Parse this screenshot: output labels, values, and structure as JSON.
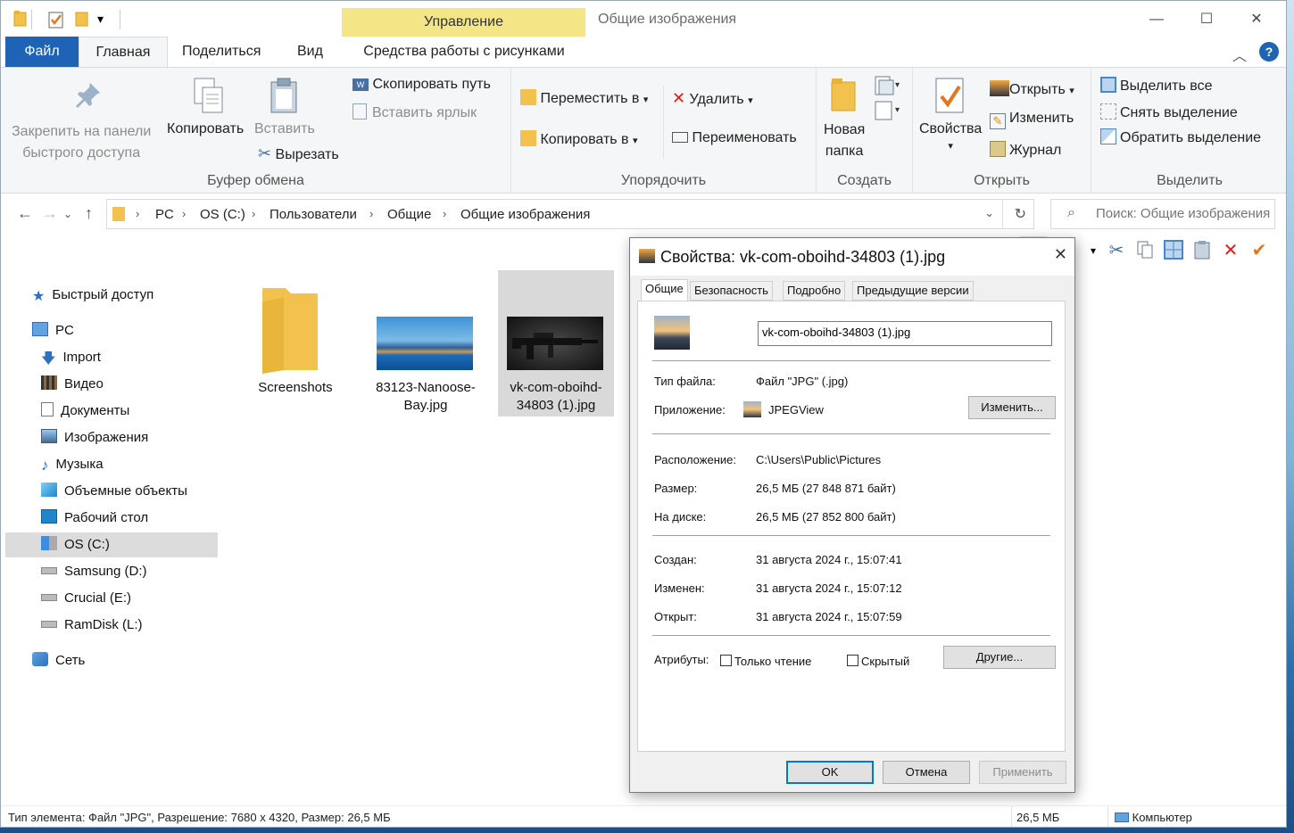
{
  "titlebar": {
    "context_tab": "Управление",
    "window_title": "Общие изображения",
    "minimize": "—",
    "maximize": "☐",
    "close": "✕"
  },
  "tabs": {
    "file": "Файл",
    "home": "Главная",
    "share": "Поделиться",
    "view": "Вид",
    "tools": "Средства работы с рисунками"
  },
  "ribbon": {
    "clipboard": {
      "pin": "Закрепить на панели быстрого доступа",
      "pin_line1": "Закрепить на панели",
      "pin_line2": "быстрого доступа",
      "copy": "Копировать",
      "paste": "Вставить",
      "copy_path": "Скопировать путь",
      "paste_shortcut": "Вставить ярлык",
      "cut": "Вырезать",
      "label": "Буфер обмена"
    },
    "organize": {
      "move_to": "Переместить в",
      "copy_to": "Копировать в",
      "delete": "Удалить",
      "rename": "Переименовать",
      "label": "Упорядочить"
    },
    "new": {
      "new_folder_line1": "Новая",
      "new_folder_line2": "папка",
      "label": "Создать"
    },
    "open": {
      "properties": "Свойства",
      "open": "Открыть",
      "edit": "Изменить",
      "history": "Журнал",
      "label": "Открыть"
    },
    "select": {
      "select_all": "Выделить все",
      "select_none": "Снять выделение",
      "invert": "Обратить выделение",
      "label": "Выделить"
    }
  },
  "address": {
    "crumbs": [
      "PC",
      "OS (C:)",
      "Пользователи",
      "Общие",
      "Общие изображения"
    ],
    "search_placeholder": "Поиск: Общие изображения"
  },
  "navpane": {
    "quick_access": "Быстрый доступ",
    "pc": "PC",
    "import": "Import",
    "video": "Видео",
    "documents": "Документы",
    "pictures": "Изображения",
    "music": "Музыка",
    "objects3d": "Объемные объекты",
    "desktop": "Рабочий стол",
    "os_c": "OS (C:)",
    "samsung": "Samsung (D:)",
    "crucial": "Crucial (E:)",
    "ramdisk": "RamDisk (L:)",
    "network": "Сеть"
  },
  "files": [
    {
      "name": "Screenshots",
      "type": "folder"
    },
    {
      "name": "83123-Nanoose-Bay.jpg",
      "line1": "83123-Nanoose-",
      "line2": "Bay.jpg",
      "type": "image"
    },
    {
      "name": "vk-com-oboihd-34803 (1).jpg",
      "line1": "vk-com-oboihd-",
      "line2": "34803 (1).jpg",
      "type": "image",
      "selected": true
    }
  ],
  "status": {
    "left": "Тип элемента: Файл \"JPG\", Разрешение: 7680 x 4320, Размер: 26,5 МБ",
    "size": "26,5 МБ",
    "computer": "Компьютер"
  },
  "dialog": {
    "title": "Свойства: vk-com-oboihd-34803 (1).jpg",
    "tabs": [
      "Общие",
      "Безопасность",
      "Подробно",
      "Предыдущие версии"
    ],
    "filename": "vk-com-oboihd-34803 (1).jpg",
    "file_type_label": "Тип файла:",
    "file_type_value": "Файл \"JPG\" (.jpg)",
    "app_label": "Приложение:",
    "app_value": "JPEGView",
    "change_button": "Изменить...",
    "location_label": "Расположение:",
    "location_value": "C:\\Users\\Public\\Pictures",
    "size_label": "Размер:",
    "size_value": "26,5 МБ (27 848 871 байт)",
    "disk_label": "На диске:",
    "disk_value": "26,5 МБ (27 852 800 байт)",
    "created_label": "Создан:",
    "created_value": "31 августа 2024 г., 15:07:41",
    "modified_label": "Изменен:",
    "modified_value": "31 августа 2024 г., 15:07:12",
    "opened_label": "Открыт:",
    "opened_value": "31 августа 2024 г., 15:07:59",
    "attributes_label": "Атрибуты:",
    "readonly_label": "Только чтение",
    "hidden_label": "Скрытый",
    "other_button": "Другие...",
    "ok": "OK",
    "cancel": "Отмена",
    "apply": "Применить"
  },
  "colors": {
    "accent": "#1e63b4",
    "context_tab": "#f4e686",
    "selection": "#d9d9d9",
    "delete_red": "#d9201d",
    "check_orange": "#e2761c"
  }
}
